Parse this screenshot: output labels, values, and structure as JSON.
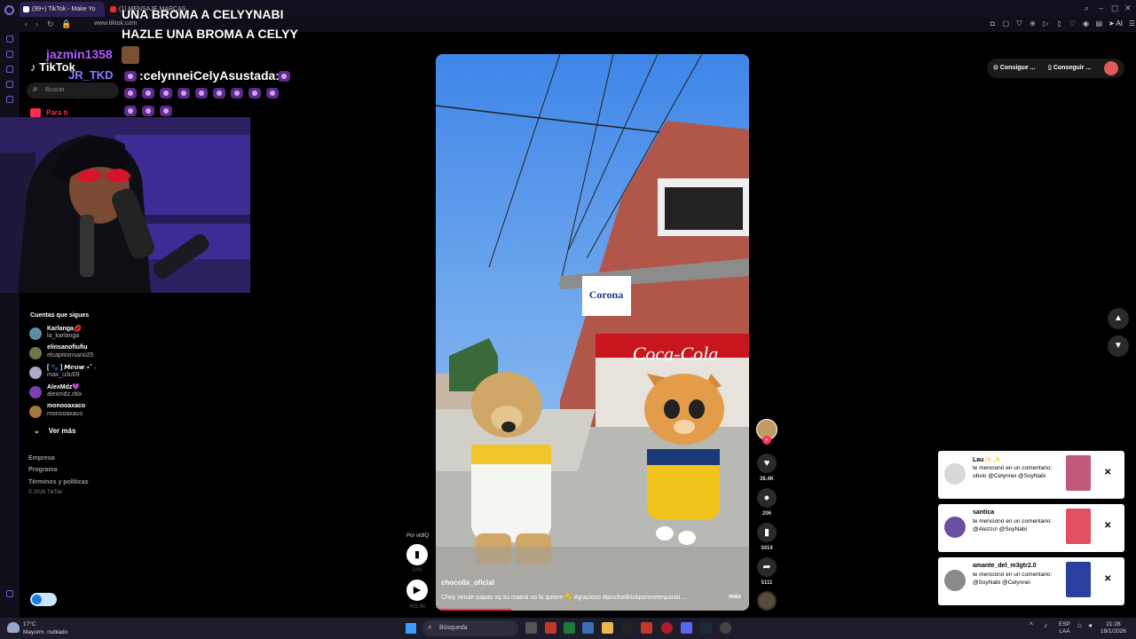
{
  "browser": {
    "tabs": [
      {
        "label": "(99+) TikTok - Make Yo"
      },
      {
        "label": "(1) MENSAJE MARCAS"
      }
    ],
    "url": "www.tiktok.com",
    "ai_label": "AI"
  },
  "overlay": {
    "title_line1": "UNA BROMA A CELYYNABI",
    "title_line2": "HAZLE UNA BROMA A CELYY",
    "chat_user": "jazmin1358",
    "chat_user2": "JR_TKD",
    "chat_message": ":celynneiCelyAsustada:"
  },
  "tiktok": {
    "logo": "TikTok",
    "search_placeholder": "Buscar",
    "for_you": "Para ti",
    "following_title": "Cuentas que sigues",
    "following": [
      {
        "name": "Karlanga💋",
        "handle": "la_karlanga",
        "color": "#5b8fa8"
      },
      {
        "name": "elinsanofiufiu",
        "handle": "elcapitoinsano25",
        "color": "#6a7a4a"
      },
      {
        "name": "[ 🐾 ] 𝙈𝙚𝙤𝙬 ⋆˚ ˖",
        "handle": "max_u3u09",
        "color": "#b0a7c8"
      },
      {
        "name": "AlexMdz💜",
        "handle": "alexmdz.rblx",
        "color": "#7a3fb0"
      },
      {
        "name": "monooaxaco",
        "handle": "monooaxaco",
        "color": "#a07a3a"
      }
    ],
    "see_more": "Ver más",
    "footer": [
      "Empresa",
      "Programa",
      "Términos y políticas"
    ],
    "copyright": "© 2026 TikTok"
  },
  "video": {
    "username": "chocolix_oficial",
    "caption": "Choy vende papas xq su mamá no lo quiere 😢 #gracioso #pinchetiktokponmeenparati ...",
    "more": "más",
    "progress": 0.24,
    "likes": "38.4K",
    "comments": "206",
    "saves": "3414",
    "shares": "5111",
    "by_label": "Por vidIQ",
    "ctrl_sub1": "10%",
    "ctrl_sub2": "459.9K"
  },
  "right": {
    "pill1": "Consigue ...",
    "pill2": "Conseguir ..."
  },
  "notifications": [
    {
      "name": "Lau✨ ✨",
      "text": "te mencionó en un comentario: obvio @Celynnei @SoyNabi",
      "avatar_color": "#d8d8d8",
      "thumb_color": "#c05a78"
    },
    {
      "name": "santica",
      "text": "te mencionó en un comentario: @Alezzo! @SoyNabi",
      "avatar_color": "#6c4fa0",
      "thumb_color": "#e05060"
    },
    {
      "name": "amante_del_m3gtr2.0",
      "text": "te mencionó en un comentario: @SoyNabi @Celynnei",
      "avatar_color": "#8a8a8a",
      "thumb_color": "#2a40a0"
    }
  ],
  "taskbar": {
    "temp": "17°C",
    "weather": "Mayorm. nublado",
    "search": "Búsqueda",
    "lang": "ESP",
    "lang2": "LAA",
    "time": "21:28",
    "date": "19/1/2026"
  }
}
